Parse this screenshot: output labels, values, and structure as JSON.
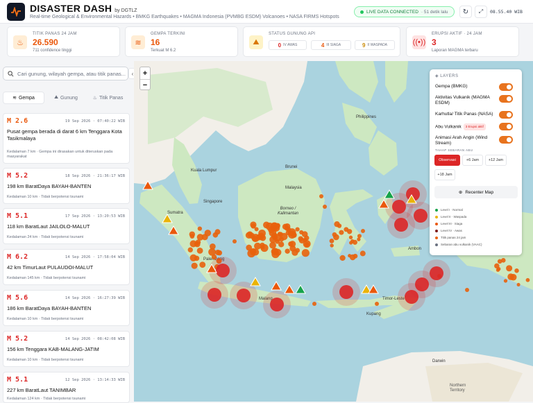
{
  "header": {
    "brand": "DISASTER DASH",
    "by": "by DGTLZ",
    "subtitle": "Real-time Geological & Environmental Hazards • BMKG Earthquakes • MAGMA Indonesia (PVMBG ESDM) Volcanoes • NASA FIRMS Hotspots",
    "live_label": "LIVE DATA CONNECTED",
    "live_ago": "· 51 detik lalu",
    "clock": "08.55.40 WIB"
  },
  "cards": {
    "titik_panas": {
      "label": "TITIK PANAS 24 JAM",
      "value": "26.590",
      "sub": "711 confidence tinggi"
    },
    "gempa": {
      "label": "GEMPA TERKINI",
      "value": "16",
      "sub": "Terkuat M 6.2"
    },
    "status_gunung": {
      "label": "STATUS GUNUNG API",
      "awas_value": "0",
      "awas_label": "IV AWAS",
      "siaga_value": "4",
      "siaga_label": "III SIAGA",
      "waspada_value": "9",
      "waspada_label": "II WASPADA"
    },
    "erupsi": {
      "label": "ERUPSI AKTIF · 24 JAM",
      "value": "3",
      "sub": "Laporan MAGMA terbaru"
    }
  },
  "sidebar": {
    "search_placeholder": "Cari gunung, wilayah gempa, atau titik panas...",
    "tabs": [
      "Gempa",
      "Gunung",
      "Titik Panas"
    ],
    "quakes": [
      {
        "mag": "M 2.6",
        "time": "19 Sep 2026 · 07:40:22 WIB",
        "loc": "Pusat gempa berada di darat 6 km Tenggara Kota Tasikmalaya",
        "det": "Kedalaman 7 km · Gempa ini dirasakan untuk diteruskan pada masyarakat"
      },
      {
        "mag": "M 5.2",
        "time": "18 Sep 2026 · 21:36:17 WIB",
        "loc": "198 km BaratDaya BAYAH-BANTEN",
        "det": "Kedalaman 10 km · Tidak berpotensi tsunami"
      },
      {
        "mag": "M 5.1",
        "time": "17 Sep 2026 · 13:20:53 WIB",
        "loc": "118 km BaratLaut JAILOLO-MALUT",
        "det": "Kedalaman 24 km · Tidak berpotensi tsunami"
      },
      {
        "mag": "M 6.2",
        "time": "14 Sep 2026 · 17:58:04 WIB",
        "loc": "42 km TimurLaut PULAUDOI-MALUT",
        "det": "Kedalaman 145 km · Tidak berpotensi tsunami"
      },
      {
        "mag": "M 5.6",
        "time": "14 Sep 2026 · 16:27:39 WIB",
        "loc": "186 km BaratDaya BAYAH-BANTEN",
        "det": "Kedalaman 10 km · Tidak berpotensi tsunami"
      },
      {
        "mag": "M 5.2",
        "time": "14 Sep 2026 · 08:42:08 WIB",
        "loc": "156 km Tenggara KAB-MALANG-JATIM",
        "det": "Kedalaman 10 km · Tidak berpotensi tsunami"
      },
      {
        "mag": "M 5.1",
        "time": "12 Sep 2026 · 13:14:33 WIB",
        "loc": "227 km BaratLaut TANIMBAR",
        "det": "Kedalaman 124 km · Tidak berpotensi tsunami"
      }
    ]
  },
  "map": {
    "zoom_in": "+",
    "zoom_out": "−",
    "labels": {
      "borneo": "Borneo / Kalimantan",
      "sumatra": "Sumatra",
      "malaysia": "Malaysia",
      "kuala_lumpur": "Kuala Lumpur",
      "singapore": "Singapore",
      "brunei": "Brunei",
      "philippines": "Philippines",
      "ambon": "Ambon",
      "malang": "Malang",
      "kupang": "Kupang",
      "timor_leste": "Timor-Leste",
      "northern_territory": "Northern Territory",
      "darwin": "Darwin",
      "palembang": "Palembang"
    },
    "colors": {
      "sea": "#aad3df",
      "land": "#f2efe9",
      "forest": "#cde8c1",
      "hotspot": "#e8620c",
      "quake": "#dc2626",
      "volcano_normal": "#16a34a",
      "volcano_waspada": "#eab308",
      "volcano_siaga": "#ea580c"
    }
  },
  "layers": {
    "title": "LAYERS",
    "items": [
      {
        "label": "Gempa (BMKG)"
      },
      {
        "label": "Aktivitas Vulkanik (MAGMA ESDM)"
      },
      {
        "label": "Karhutla/ Titik Panas (NASA)"
      },
      {
        "label": "Abu Vulkanik",
        "badge": "3 Erupsi aktif"
      },
      {
        "label": "Animasi Arah Angin (Wind Stream)"
      }
    ],
    "sebaran_label": "TAHAP SEBARAN ABU",
    "sebaran": [
      "Observasi",
      "+6 Jam",
      "+12 Jam",
      "+18 Jam"
    ],
    "recenter": "Recenter Map",
    "legend": [
      {
        "label": "Level I · Normal",
        "color": "#16a34a"
      },
      {
        "label": "Level II · Waspada",
        "color": "#eab308"
      },
      {
        "label": "Level III · Siaga",
        "color": "#ea580c"
      },
      {
        "label": "Level IV · Awas",
        "color": "#7f1d1d"
      },
      {
        "label": "Titik panas 24 jam",
        "color": "#e8620c"
      },
      {
        "label": "Sebaran abu vulkanik (VAAC)",
        "color": "#6b7280"
      }
    ]
  }
}
